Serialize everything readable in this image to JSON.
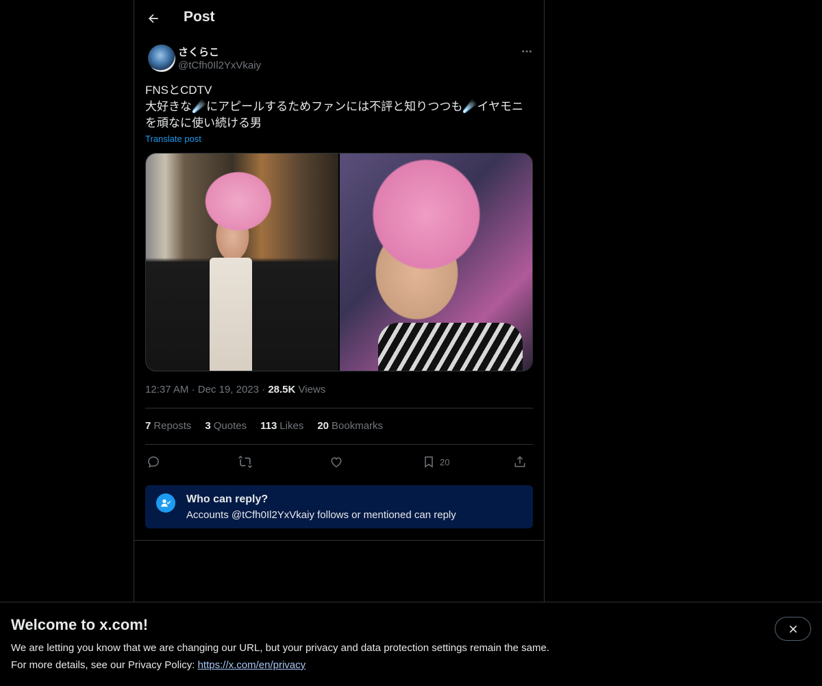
{
  "header": {
    "title": "Post"
  },
  "post": {
    "display_name": "さくらこ",
    "handle": "@tCfh0Il2YxVkaiy",
    "text": "FNSとCDTV\n大好きな☄️にアピールするためファンには不評と知りつつも☄️イヤモニを頑なに使い続ける男",
    "translate_label": "Translate post",
    "time": "12:37 AM",
    "date": "Dec 19, 2023",
    "views_count": "28.5K",
    "views_label": "Views",
    "separator": "·"
  },
  "stats": [
    {
      "num": "7",
      "label": "Reposts"
    },
    {
      "num": "3",
      "label": "Quotes"
    },
    {
      "num": "113",
      "label": "Likes"
    },
    {
      "num": "20",
      "label": "Bookmarks"
    }
  ],
  "actions": {
    "reply_icon": "reply-icon",
    "repost_icon": "repost-icon",
    "like_icon": "heart-icon",
    "bookmark_icon": "bookmark-icon",
    "bookmark_count": "20",
    "share_icon": "share-icon"
  },
  "reply_notice": {
    "title": "Who can reply?",
    "subtitle": "Accounts @tCfh0Il2YxVkaiy follows or mentioned can reply"
  },
  "banner": {
    "title": "Welcome to x.com!",
    "line1": "We are letting you know that we are changing our URL, but your privacy and data protection settings remain the same.",
    "line2_prefix": "For more details, see our Privacy Policy: ",
    "link": "https://x.com/en/privacy"
  },
  "colors": {
    "background": "#000000",
    "text": "#e7e9ea",
    "muted": "#71767b",
    "accent": "#1d9bf0",
    "reply_box": "#041a46"
  }
}
